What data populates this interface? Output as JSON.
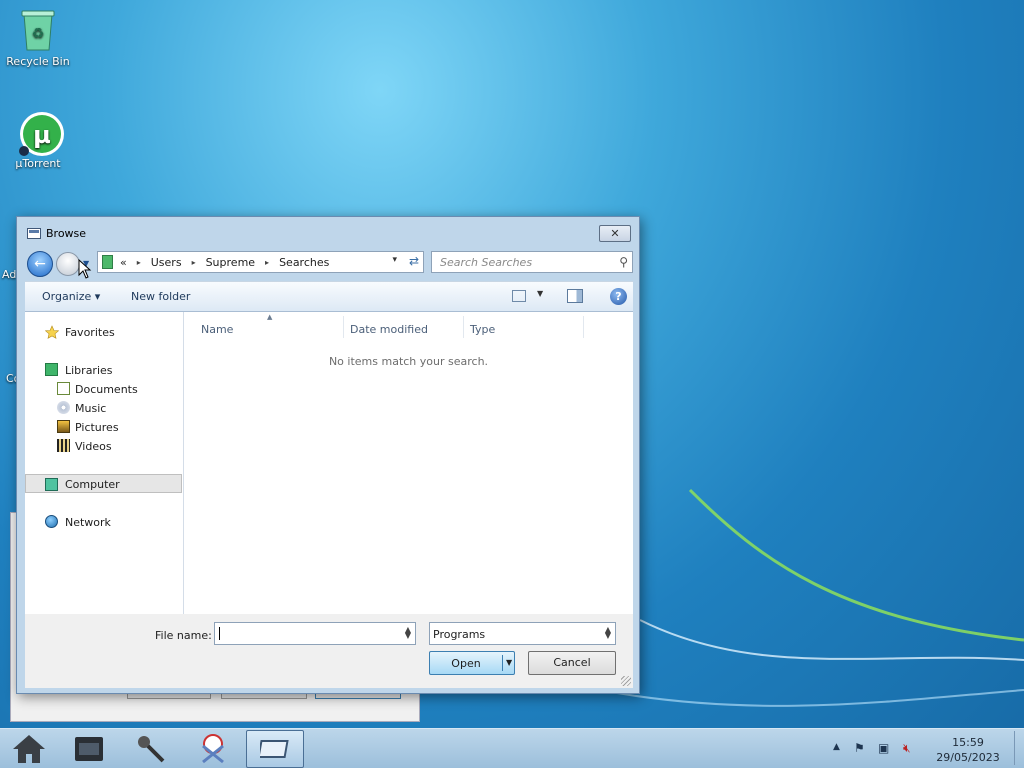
{
  "desktop": {
    "icons": [
      {
        "label": "Recycle Bin"
      },
      {
        "label": "µTorrent"
      }
    ],
    "clipped_labels": [
      "Ad",
      "Co"
    ]
  },
  "dialog": {
    "title": "Browse",
    "close_glyph": "✕",
    "address": {
      "overflow": "«",
      "crumbs": [
        "Users",
        "Supreme",
        "Searches"
      ],
      "dropdown_glyph": "▾",
      "refresh_glyph": "⇄"
    },
    "search_placeholder": "Search Searches",
    "commands": {
      "organize": "Organize ▾",
      "new_folder": "New folder",
      "help_glyph": "?"
    },
    "nav": {
      "favorites": "Favorites",
      "libraries": "Libraries",
      "documents": "Documents",
      "music": "Music",
      "pictures": "Pictures",
      "videos": "Videos",
      "computer": "Computer",
      "network": "Network"
    },
    "columns": [
      "Name",
      "Date modified",
      "Type"
    ],
    "empty_message": "No items match your search.",
    "footer": {
      "file_name_label": "File name:",
      "file_name_value": "",
      "file_type_value": "Programs",
      "open_label": "Open",
      "cancel_label": "Cancel"
    }
  },
  "taskbar": {
    "items": [
      "home-icon",
      "film-strip-icon",
      "microphone-icon",
      "scissors-icon",
      "window-icon"
    ],
    "clock_time": "15:59",
    "clock_date": "29/05/2023"
  },
  "colors": {
    "desktop_accent": "#3fa8db",
    "dialog_frame": "#bfd6ea",
    "open_button": "#a7d9f5"
  }
}
